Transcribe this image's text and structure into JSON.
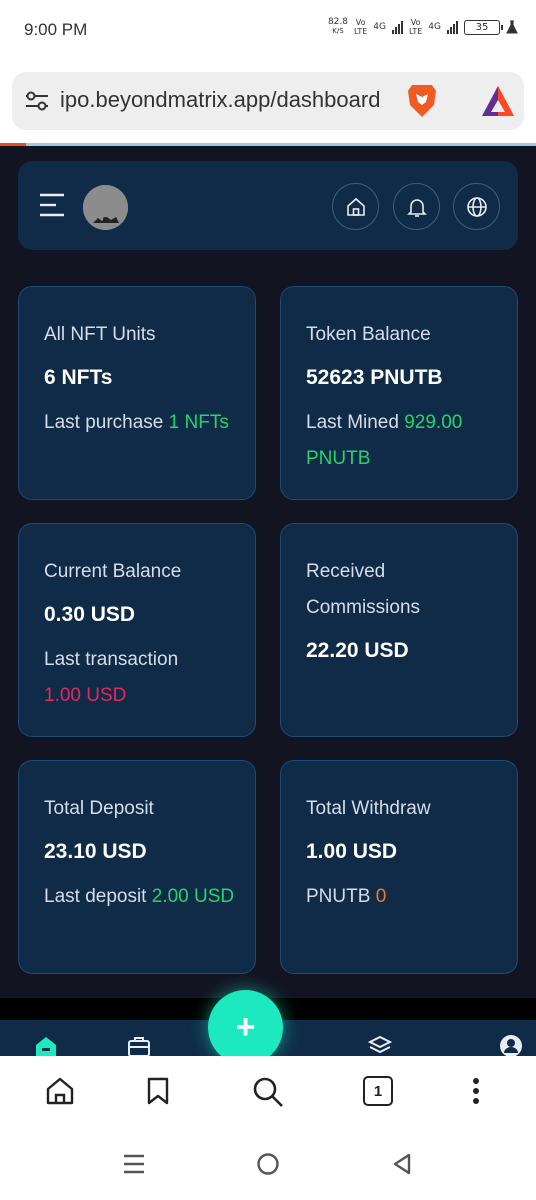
{
  "status_bar": {
    "time": "9:00 PM",
    "speed_value": "82.8",
    "speed_unit": "K/S",
    "net1_top": "Vo",
    "net1_bottom": "LTE",
    "net1_gen": "4G",
    "net2_top": "Vo",
    "net2_bottom": "LTE",
    "net2_gen": "4G",
    "battery": "35"
  },
  "browser": {
    "url": "ipo.beyondmatrix.app/dashboard",
    "open_tabs": "1"
  },
  "cards": {
    "nft": {
      "title": "All NFT Units",
      "value": "6 NFTs",
      "sub_label": "Last purchase",
      "sub_value": "1 NFTs"
    },
    "token": {
      "title": "Token Balance",
      "value": "52623 PNUTB",
      "sub_label": "Last Mined",
      "sub_value": "929.00 PNUTB"
    },
    "balance": {
      "title": "Current Balance",
      "value": "0.30 USD",
      "sub_label": "Last transaction",
      "sub_value": "1.00 USD"
    },
    "commissions": {
      "title": "Received Commissions",
      "value": "22.20 USD"
    },
    "deposit": {
      "title": "Total Deposit",
      "value": "23.10 USD",
      "sub_label": "Last deposit",
      "sub_value": "2.00 USD"
    },
    "withdraw": {
      "title": "Total Withdraw",
      "value": "1.00 USD",
      "sub_label": "PNUTB",
      "sub_value": "0"
    }
  },
  "fab": {
    "label": "+"
  },
  "colors": {
    "app_bg": "#121422",
    "card_bg": "#0f2b47",
    "positive": "#29d36b",
    "negative": "#e8265e",
    "neutral_accent": "#f07a2a",
    "fab": "#1de9c0"
  },
  "icons": {
    "header": [
      "menu-icon",
      "home-icon",
      "bell-icon",
      "globe-icon"
    ],
    "app_nav": [
      "home-icon",
      "briefcase-icon",
      "layers-icon",
      "user-icon"
    ],
    "browser_toolbar": [
      "home-icon",
      "bookmark-icon",
      "search-icon",
      "tabs-icon",
      "more-icon"
    ],
    "system_nav": [
      "recents-icon",
      "home-icon",
      "back-icon"
    ]
  }
}
